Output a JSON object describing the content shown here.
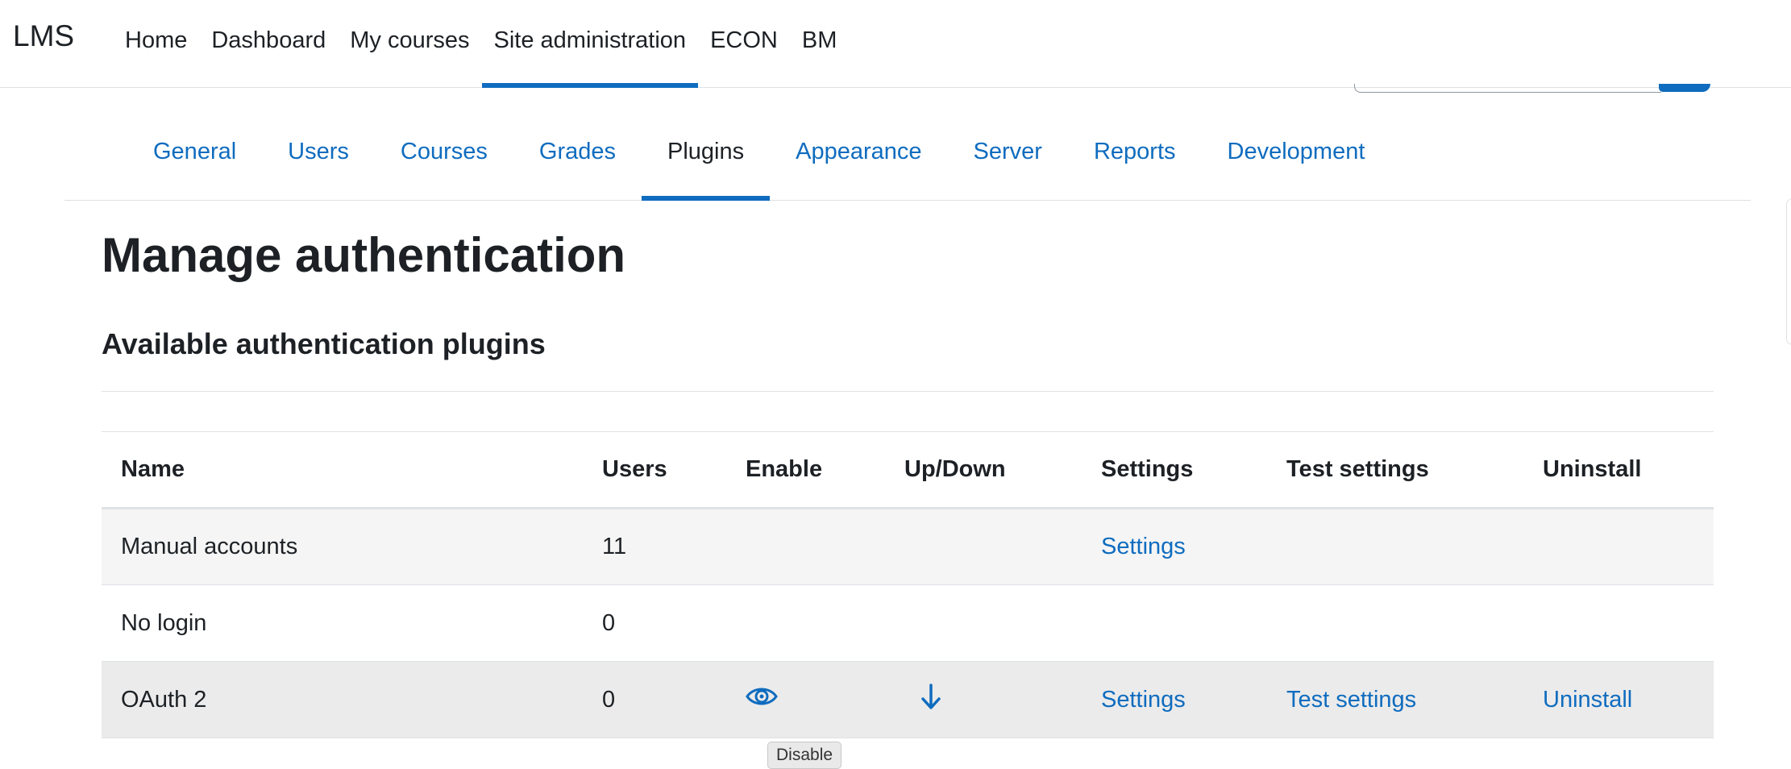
{
  "brand": "LMS",
  "primary_nav": [
    "Home",
    "Dashboard",
    "My courses",
    "Site administration",
    "ECON",
    "BM"
  ],
  "secondary_nav": [
    "General",
    "Users",
    "Courses",
    "Grades",
    "Plugins",
    "Appearance",
    "Server",
    "Reports",
    "Development"
  ],
  "page_title": "Manage authentication",
  "section_title": "Available authentication plugins",
  "table": {
    "headers": [
      "Name",
      "Users",
      "Enable",
      "Up/Down",
      "Settings",
      "Test settings",
      "Uninstall"
    ],
    "rows": [
      {
        "name": "Manual accounts",
        "users": "11",
        "settings": "Settings",
        "test_settings": "",
        "uninstall": ""
      },
      {
        "name": "No login",
        "users": "0",
        "settings": "",
        "test_settings": "",
        "uninstall": ""
      },
      {
        "name": "OAuth 2",
        "users": "0",
        "enable_icon": "eye-icon",
        "updown_icon": "arrow-down-icon",
        "settings": "Settings",
        "test_settings": "Test settings",
        "uninstall": "Uninstall"
      }
    ]
  },
  "tooltip": "Disable",
  "colors": {
    "link": "#0f6cbf",
    "text": "#1d2125",
    "active_underline": "#0f6cbf"
  }
}
